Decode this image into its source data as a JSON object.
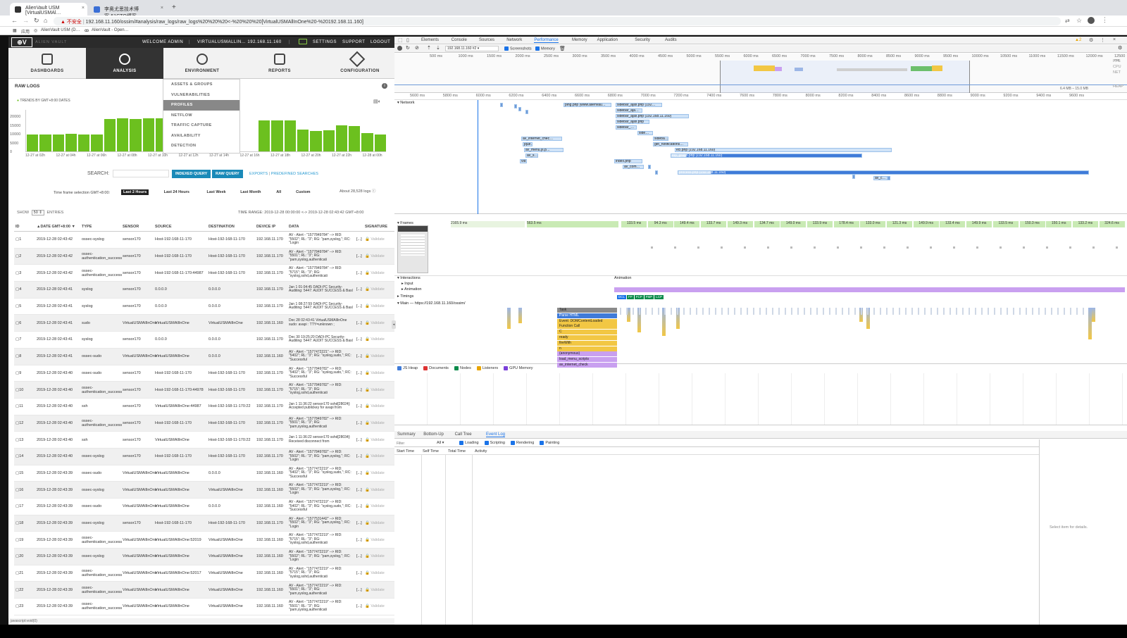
{
  "browser": {
    "tabs": [
      {
        "title": "AlienVault USM [VirtualUSMAl…",
        "active": true
      },
      {
        "title": "李奥尤思技术博客-51CTO博客",
        "active": false
      }
    ],
    "security": "不安全",
    "url": "192.168.11.160/ossim/#analysis/raw_logs/raw_logs%20%20%20<-%20%20%20[VirtualUSMAllInOne%20-%20192.168.11.160]",
    "bookmarks": [
      "应用",
      "AlienVault USM (D…",
      "AlienVault - Open…"
    ]
  },
  "alienvault": {
    "logo": "ALIEN VAULT",
    "topbar": {
      "welcome": "WELCOME ADMIN",
      "host": "VIRTUALUSMALLIN… 192.168.11.160",
      "settings": "SETTINGS",
      "support": "SUPPORT",
      "logout": "LOGOUT"
    },
    "nav": [
      {
        "label": "DASHBOARDS",
        "icon": "bar-chart-icon"
      },
      {
        "label": "ANALYSIS",
        "icon": "radar-icon",
        "active": true
      },
      {
        "label": "ENVIRONMENT",
        "icon": "planet-icon"
      },
      {
        "label": "REPORTS",
        "icon": "document-icon"
      },
      {
        "label": "CONFIGURATION",
        "icon": "tools-icon"
      }
    ],
    "submenu": [
      "ASSETS & GROUPS",
      "VULNERABILITIES",
      "PROFILES",
      "NETFLOW",
      "TRAFFIC CAPTURE",
      "AVAILABILITY",
      "DETECTION"
    ],
    "submenu_active": "PROFILES",
    "section_title": "RAW LOGS",
    "trends_label": "TRENDS BY GMT+8:00 DATES",
    "chart_data": {
      "type": "bar",
      "y_ticks": [
        "20000",
        "15000",
        "10000",
        "5000",
        "0"
      ],
      "ylim": [
        0,
        24000
      ],
      "x_ticks": [
        "12-27 at 02h",
        "12-27 at 04h",
        "12-27 at 06h",
        "12-27 at 08h",
        "12-27 at 10h",
        "12-27 at 12h",
        "12-27 at 14h",
        "12-27 at 16h",
        "12-27 at 18h",
        "12-27 at 20h",
        "12-27 at 22h",
        "12-28 at 00h"
      ],
      "values": [
        9500,
        9800,
        9600,
        10000,
        9700,
        9800,
        18500,
        18800,
        18600,
        18900,
        18700,
        0,
        0,
        0,
        0,
        0,
        0,
        0,
        17500,
        17800,
        17600,
        12500,
        11600,
        12200,
        14800,
        14500,
        10500,
        9800
      ],
      "bar_color": "#6cc01f"
    },
    "search": {
      "label": "SEARCH:",
      "placeholder": "",
      "indexed_query": "INDEXED QUERY",
      "raw_query": "RAW QUERY",
      "exports": "EXPORTS",
      "separator": "|",
      "predefined": "PREDEFINED SEARCHES"
    },
    "timeframe": {
      "label": "Time frame selection GMT+8:00:",
      "options": [
        "Last 2 Hours",
        "Last 24 Hours",
        "Last Week",
        "Last Month",
        "All",
        "Custom"
      ],
      "active": "Last 2 Hours",
      "about": "About 28,528 logs"
    },
    "show": {
      "label": "SHOW",
      "value": "50",
      "entries": "ENTRIES"
    },
    "time_range": "TIME RANGE: 2019-12-28 00:00:00 <-> 2019-12-28 02:43:42 GMT+8:00",
    "table": {
      "columns": [
        "ID",
        "▲DATE GMT+8:00 ▼",
        "TYPE",
        "SENSOR",
        "SOURCE",
        "DESTINATION",
        "DEVICE IP",
        "DATA",
        "SIGNATURE"
      ],
      "rows": [
        [
          "1",
          "2019-12-28 02:43:42",
          "ossec-syslog",
          "sensor170",
          "Host-192-168-11-170",
          "Host-192-168-11-170",
          "192.168.11.170",
          "AV - Alert - \"1577849784\" --> RID: \"5502\"; RL: \"3\"; RG: \"pam,syslog,\"; RC: \"Login",
          "[...]",
          "Validate"
        ],
        [
          "2",
          "2019-12-28 02:43:42",
          "ossec-authentication_success",
          "sensor170",
          "Host-192-168-11-170",
          "Host-192-168-11-170",
          "192.168.11.170",
          "AV - Alert - \"1577849784\" --> RID: \"5501\"; RL: \"3\"; RG: \"pam,syslog,authenticati",
          "[...]",
          "Validate"
        ],
        [
          "3",
          "2019-12-28 02:43:42",
          "ossec-authentication_success",
          "sensor170",
          "Host-192-168-11-170:44987",
          "Host-192-168-11-170",
          "192.168.11.170",
          "AV - Alert - \"1577849784\" --> RID: \"5715\"; RL: \"3\"; RG: \"syslog,sshd,authenticati",
          "[...]",
          "Validate"
        ],
        [
          "4",
          "2019-12-28 02:43:41",
          "syslog",
          "sensor170",
          "0.0.0.0",
          "0.0.0.0",
          "192.168.11.170",
          "Jan 1 01:04:45 DADI-PC Security-Auditing: 5447: AUDIT SUCCESS & Basl",
          "[...]",
          "Validate"
        ],
        [
          "5",
          "2019-12-28 02:43:41",
          "syslog",
          "sensor170",
          "0.0.0.0",
          "0.0.0.0",
          "192.168.11.170",
          "Jan 1 08:27:59 DADI-PC Security-Auditing: 5447: AUDIT SUCCESS & Basl",
          "[...]",
          "Validate"
        ],
        [
          "6",
          "2019-12-28 02:43:41",
          "sudo",
          "VirtualUSMAllInOne",
          "VirtualUSMAllInOne",
          "VirtualUSMAllInOne",
          "192.168.11.160",
          "Dec 28 02:43:41 VirtualUSMAllInOne sudo: avapi : TTY=unknown ;",
          "[...]",
          "Validate"
        ],
        [
          "7",
          "2019-12-28 02:43:41",
          "syslog",
          "sensor170",
          "0.0.0.0",
          "0.0.0.0",
          "192.168.11.170",
          "Dec 30 19:25:20 DADI-PC Security-Auditing: 5447: AUDIT SUCCESS & Basl",
          "[...]",
          "Validate"
        ],
        [
          "8",
          "2019-12-28 02:43:41",
          "ossec-sudo",
          "VirtualUSMAllInOne",
          "VirtualUSMAllInOne",
          "0.0.0.0",
          "192.168.11.160",
          "AV - Alert - \"1577472221\" --> RID: \"5402\"; RL: \"3\"; RG: \"syslog,sudo,\"; RC: \"Successful",
          "[...]",
          "Validate"
        ],
        [
          "9",
          "2019-12-28 02:43:40",
          "ossec-sudo",
          "sensor170",
          "Host-192-168-11-170",
          "Host-192-168-11-170",
          "192.168.11.170",
          "AV - Alert - \"1577849782\" --> RID: \"5402\"; RL: \"3\"; RG: \"syslog,sudo,\"; RC: \"Successful",
          "[...]",
          "Validate"
        ],
        [
          "10",
          "2019-12-28 02:43:40",
          "ossec-authentication_success",
          "sensor170",
          "Host-192-168-11-170:44978",
          "Host-192-168-11-170",
          "192.168.11.170",
          "AV - Alert - \"1577849782\" --> RID: \"5715\"; RL: \"3\"; RG: \"syslog,sshd,authenticati",
          "[...]",
          "Validate"
        ],
        [
          "11",
          "2019-12-28 02:43:40",
          "ssh",
          "sensor170",
          "VirtualUSMAllInOne:44987",
          "Host-192-168-11-170:22",
          "192.168.11.170",
          "Jan 1 11:36:22 sensor170 sshd[28024]: Accepted publickey for avapi from",
          "[...]",
          "Validate"
        ],
        [
          "12",
          "2019-12-28 02:43:40",
          "ossec-authentication_success",
          "sensor170",
          "Host-192-168-11-170",
          "Host-192-168-11-170",
          "192.168.11.170",
          "AV - Alert - \"1577849782\" --> RID: \"5501\"; RL: \"3\"; RG: \"pam,syslog,authenticati",
          "[...]",
          "Validate"
        ],
        [
          "13",
          "2019-12-28 02:43:40",
          "ssh",
          "sensor170",
          "VirtualUSMAllInOne",
          "Host-192-168-11-170:22",
          "192.168.11.170",
          "Jan 1 11:36:22 sensor170 sshd[28034]: Received disconnect from",
          "[...]",
          "Validate"
        ],
        [
          "14",
          "2019-12-28 02:43:40",
          "ossec-syslog",
          "sensor170",
          "Host-192-168-11-170",
          "Host-192-168-11-170",
          "192.168.11.170",
          "AV - Alert - \"1577849782\" --> RID: \"5502\"; RL: \"3\"; RG: \"pam,syslog,\"; RC: \"Login",
          "[...]",
          "Validate"
        ],
        [
          "15",
          "2019-12-28 02:43:39",
          "ossec-sudo",
          "VirtualUSMAllInOne",
          "VirtualUSMAllInOne",
          "0.0.0.0",
          "192.168.11.160",
          "AV - Alert - \"1577472219\" --> RID: \"5402\"; RL: \"3\"; RG: \"syslog,sudo,\"; RC: \"Successful",
          "[...]",
          "Validate"
        ],
        [
          "16",
          "2019-12-28 02:43:39",
          "ossec-syslog",
          "VirtualUSMAllInOne",
          "VirtualUSMAllInOne",
          "VirtualUSMAllInOne",
          "192.168.11.160",
          "AV - Alert - \"1577472219\" --> RID: \"5502\"; RL: \"3\"; RG: \"pam,syslog,\"; RC: \"Login",
          "[...]",
          "Validate"
        ],
        [
          "17",
          "2019-12-28 02:43:39",
          "ossec-sudo",
          "VirtualUSMAllInOne",
          "VirtualUSMAllInOne",
          "0.0.0.0",
          "192.168.11.160",
          "AV - Alert - \"1577472219\" --> RID: \"5402\"; RL: \"3\"; RG: \"syslog,sudo,\"; RC: \"Successful",
          "[...]",
          "Validate"
        ],
        [
          "18",
          "2019-12-28 02:43:39",
          "ossec-syslog",
          "sensor170",
          "Host-192-168-11-170",
          "Host-192-168-11-170",
          "192.168.11.170",
          "AV - Alert - \"1577531442\" --> RID: \"5502\"; RL: \"3\"; RG: \"pam,syslog,\"; RC: \"Login",
          "[...]",
          "Validate"
        ],
        [
          "19",
          "2019-12-28 02:43:39",
          "ossec-authentication_success",
          "VirtualUSMAllInOne",
          "VirtualUSMAllInOne:52019",
          "VirtualUSMAllInOne",
          "192.168.11.160",
          "AV - Alert - \"1577472219\" --> RID: \"5715\"; RL: \"3\"; RG: \"syslog,sshd,authenticati",
          "[...]",
          "Validate"
        ],
        [
          "20",
          "2019-12-28 02:43:39",
          "ossec-syslog",
          "VirtualUSMAllInOne",
          "VirtualUSMAllInOne",
          "VirtualUSMAllInOne",
          "192.168.11.160",
          "AV - Alert - \"1577472219\" --> RID: \"5502\"; RL: \"3\"; RG: \"pam,syslog,\"; RC: \"Login",
          "[...]",
          "Validate"
        ],
        [
          "21",
          "2019-12-28 02:43:39",
          "ossec-authentication_success",
          "VirtualUSMAllInOne",
          "VirtualUSMAllInOne:52017",
          "VirtualUSMAllInOne",
          "192.168.11.160",
          "AV - Alert - \"1577472219\" --> RID: \"5715\"; RL: \"3\"; RG: \"syslog,sshd,authenticati",
          "[...]",
          "Validate"
        ],
        [
          "22",
          "2019-12-28 02:43:39",
          "ossec-authentication_success",
          "VirtualUSMAllInOne",
          "VirtualUSMAllInOne",
          "VirtualUSMAllInOne",
          "192.168.11.160",
          "AV - Alert - \"1577472219\" --> RID: \"5501\"; RL: \"3\"; RG: \"pam,syslog,authenticati",
          "[...]",
          "Validate"
        ],
        [
          "23",
          "2019-12-28 02:43:39",
          "ossec-authentication_success",
          "VirtualUSMAllInOne",
          "VirtualUSMAllInOne",
          "VirtualUSMAllInOne",
          "192.168.11.160",
          "AV - Alert - \"1577472219\" --> RID: \"5501\"; RL: \"3\"; RG: \"pam,syslog,authenticati",
          "[...]",
          "Validate"
        ]
      ]
    },
    "status_url": "javascript:void(0)"
  },
  "devtools": {
    "tabs": [
      "Elements",
      "Console",
      "Sources",
      "Network",
      "Performance",
      "Memory",
      "Application",
      "Security",
      "Audits"
    ],
    "active_tab": "Performance",
    "warnings": "2",
    "toolbar": {
      "recording": "192.168.11.160 #2",
      "screenshots": "Screenshots",
      "memory": "Memory"
    },
    "overview_ticks": [
      "500 ms",
      "1000 ms",
      "1500 ms",
      "2000 ms",
      "2500 ms",
      "3000 ms",
      "3500 ms",
      "4000 ms",
      "4500 ms",
      "5000 ms",
      "5500 ms",
      "6000 ms",
      "6500 ms",
      "7000 ms",
      "7500 ms",
      "8000 ms",
      "8500 ms",
      "9000 ms",
      "9500 ms",
      "10000 ms",
      "10500 ms",
      "11000 ms",
      "11500 ms",
      "12000 ms",
      "12500 ms"
    ],
    "overview_labels": [
      "FPS",
      "CPU",
      "NET",
      "HEAP"
    ],
    "heap_range": "6.4 MB – 15.0 MB",
    "detail_ticks": [
      "5600 ms",
      "5800 ms",
      "6000 ms",
      "6200 ms",
      "6400 ms",
      "6600 ms",
      "6800 ms",
      "7000 ms",
      "7200 ms",
      "7400 ms",
      "7600 ms",
      "7800 ms",
      "8000 ms",
      "8200 ms",
      "8400 ms",
      "8600 ms",
      "8800 ms",
      "9000 ms",
      "9200 ms",
      "9400 ms",
      "9600 ms"
    ],
    "network_label": "Network",
    "network_requests": [
      "ping.php (www.alienvau…",
      "sidebar_ajax.php (192…",
      "sidebar_aja…",
      "sidebar_ajax.php (192.168.11.160)",
      "sidebar_ajax.php",
      "sidebar_…",
      "side…",
      "sideba…",
      "get_notifications…",
      "ecl.php (192.168.11.160)",
      "top_graph.php (192.168.11.160)",
      "index.php",
      "av_com…",
      "process.php (192.168.11.160)",
      "av_internet_chec…",
      "jque…",
      "av_menu.js.p…",
      "av_s…",
      "vid…",
      "av_c…"
    ],
    "frames_label": "Frames",
    "frames": [
      "2165.9 ms",
      "563.5 ms",
      "133.5 ms",
      "94.3 ms",
      "149.4 ms",
      "133.7 ms",
      "149.3 ms",
      "134.7 ms",
      "149.0 ms",
      "133.9 ms",
      "178.4 ms",
      "133.0 ms",
      "121.3 ms",
      "149.9 ms",
      "133.4 ms",
      "149.9 ms",
      "133.5 ms",
      "150.3 ms",
      "150.1 ms",
      "133.2 ms",
      "324.6 ms"
    ],
    "interactions": {
      "label": "Interactions",
      "input": "Input",
      "animation": "Animation",
      "animation_track": "Animation"
    },
    "timings": {
      "label": "Timings",
      "markers": [
        "DCL",
        "FP",
        "FCP",
        "FMP",
        "LCP"
      ]
    },
    "main": {
      "label": "Main — https://192.168.11.160/ossim/",
      "flame": [
        "Task",
        "Parse HTML",
        "Event: DOMContentLoaded",
        "Function Call",
        "C",
        "ready",
        "fireWith",
        "n",
        "(anonymous)",
        "load_menu_scripts",
        "av_internet_check"
      ]
    },
    "memory_counters": [
      "JS Heap",
      "Documents",
      "Nodes",
      "Listeners",
      "GPU Memory"
    ],
    "bottom_tabs": [
      "Summary",
      "Bottom-Up",
      "Call Tree",
      "Event Log"
    ],
    "active_bottom_tab": "Event Log",
    "filter": {
      "placeholder": "Filter",
      "all": "All",
      "checks": [
        "Loading",
        "Scripting",
        "Rendering",
        "Painting"
      ]
    },
    "log_columns": [
      "Start Time",
      "Self Time",
      "Total Time",
      "Activity"
    ],
    "details": "Select item for details.",
    "colors": {
      "accent": "#1a73e8",
      "task": "#8a8a8a",
      "parse": "#3f7bd9",
      "scripting": "#f2c744",
      "anon": "#c9a0f0",
      "network_bar": "#d0e3f7"
    }
  }
}
